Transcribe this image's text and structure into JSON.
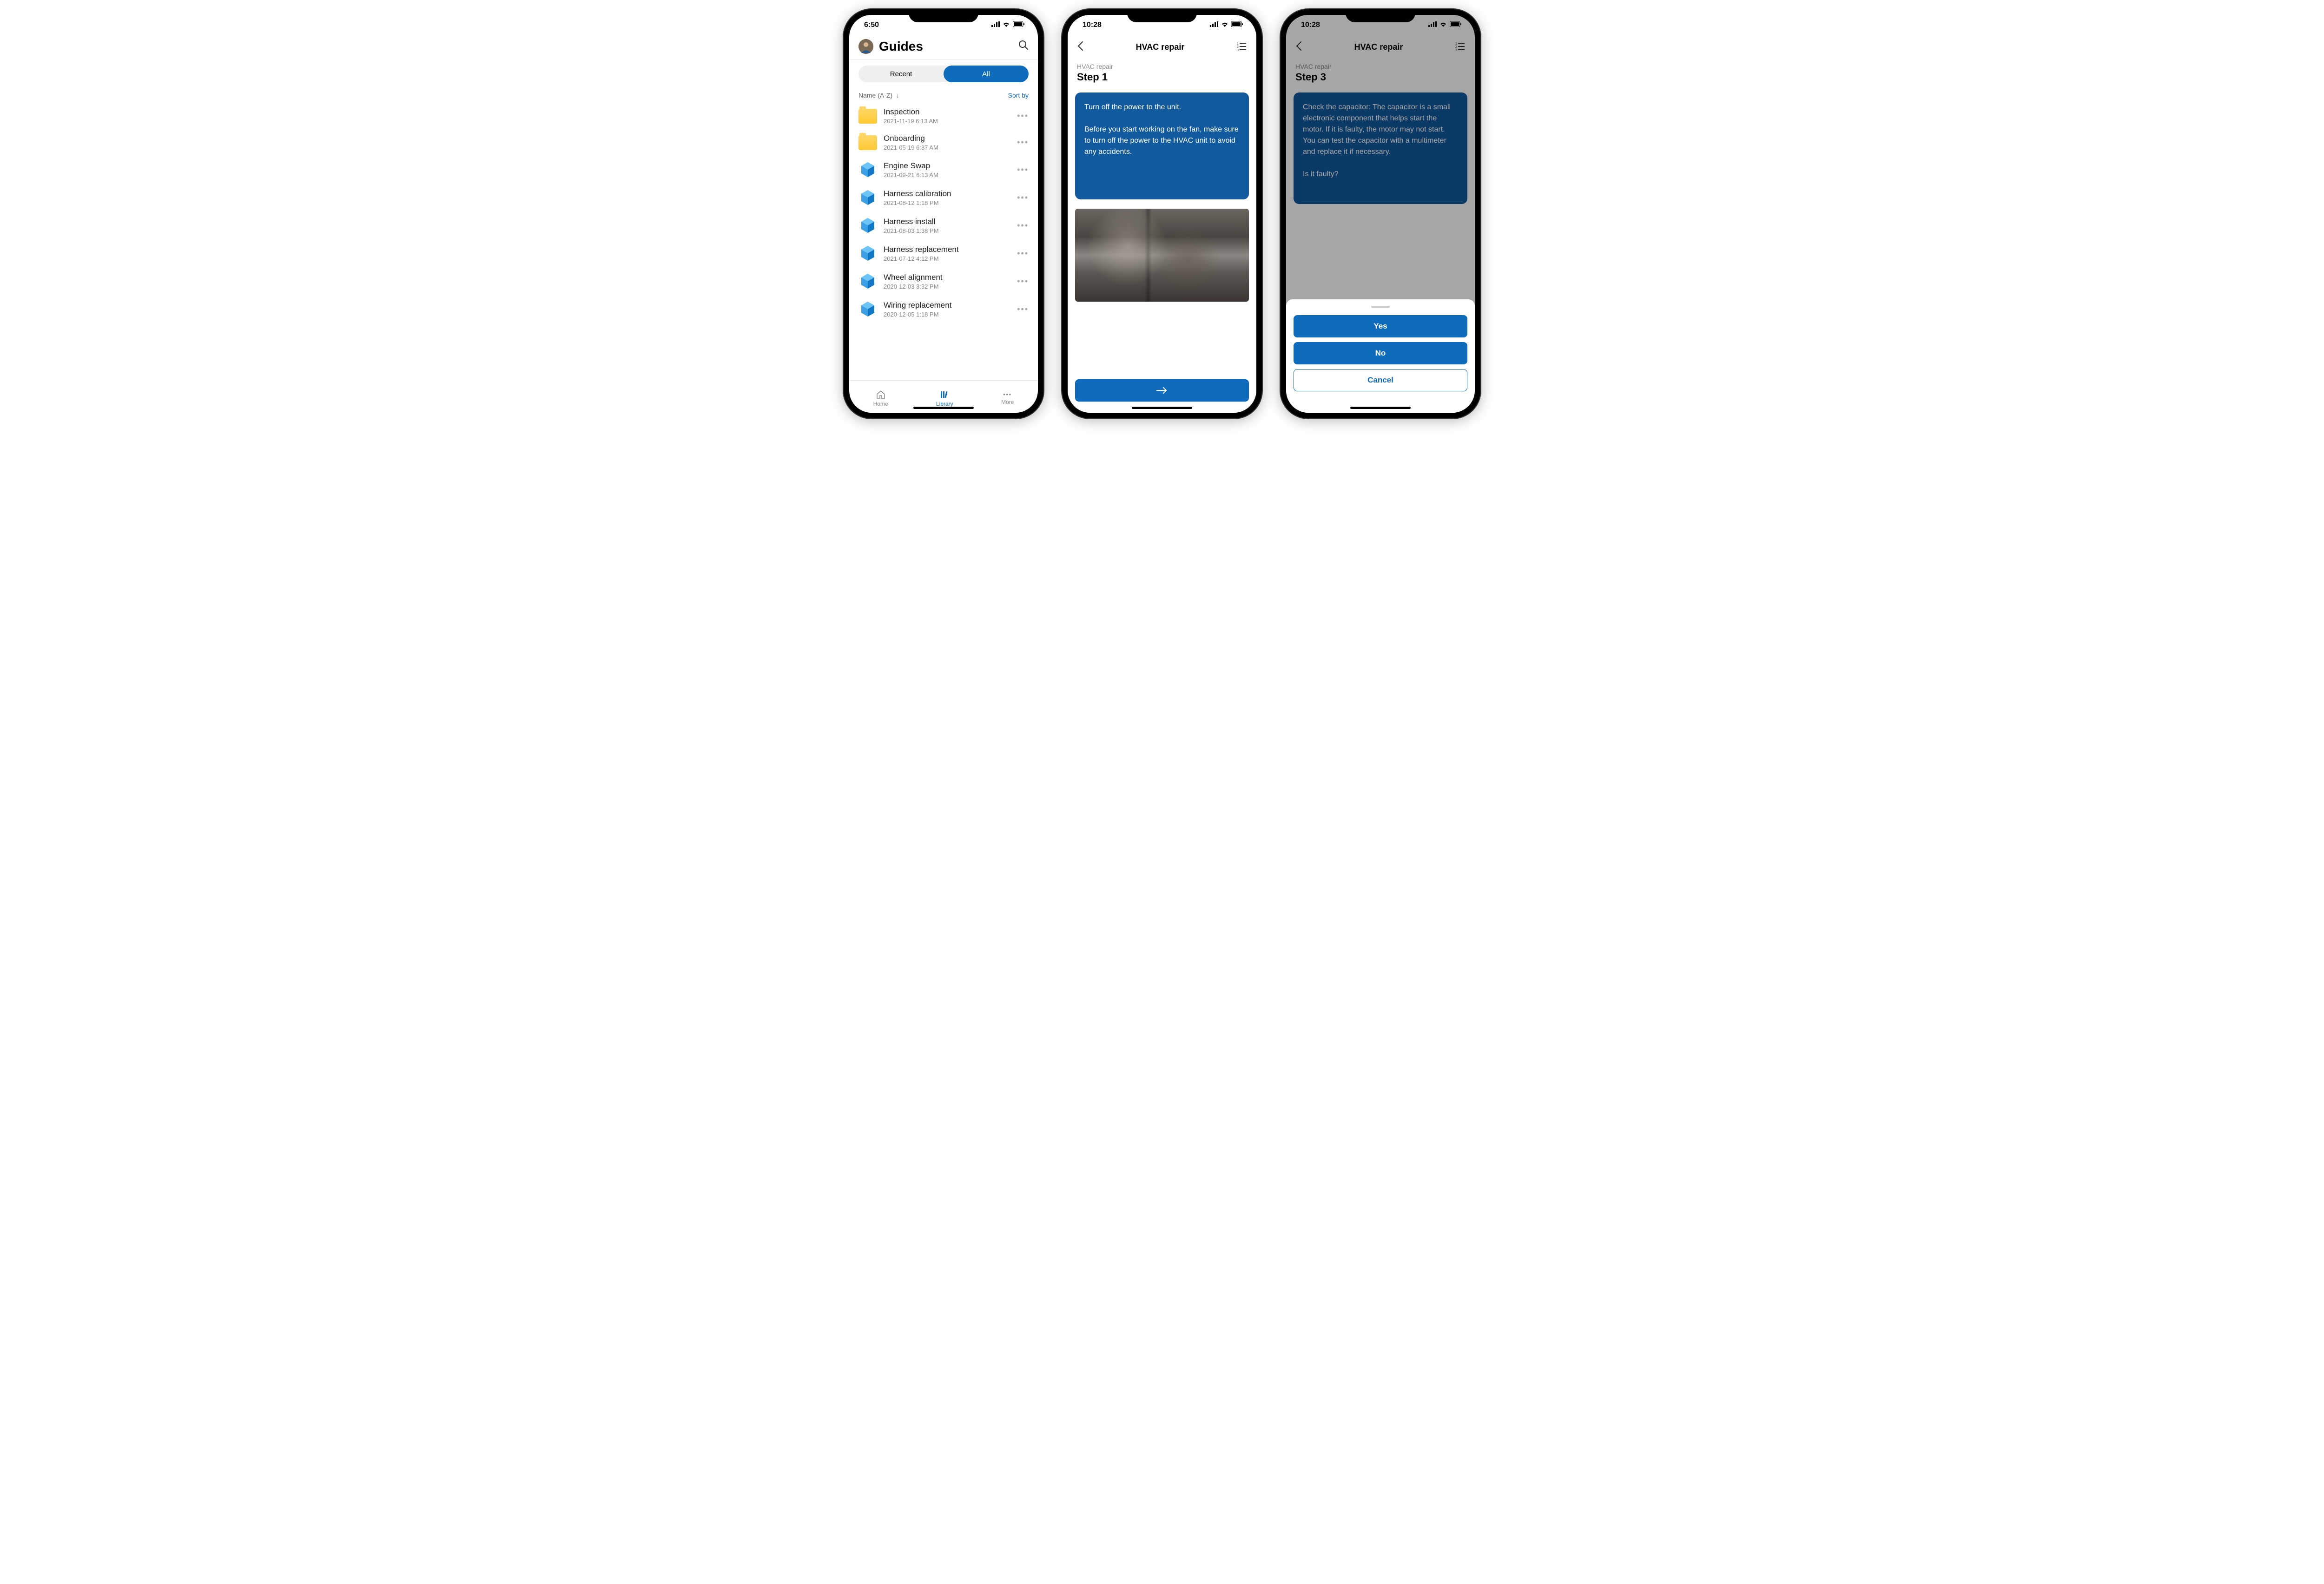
{
  "phone1": {
    "time": "6:50",
    "title": "Guides",
    "segments": {
      "recent": "Recent",
      "all": "All"
    },
    "sort_label": "Name (A-Z)",
    "sort_link": "Sort by",
    "items": [
      {
        "type": "folder",
        "title": "Inspection",
        "sub": "2021-11-19 6:13 AM"
      },
      {
        "type": "folder",
        "title": "Onboarding",
        "sub": "2021-05-19 6:37 AM"
      },
      {
        "type": "guide",
        "title": "Engine Swap",
        "sub": "2021-09-21 6:13 AM"
      },
      {
        "type": "guide",
        "title": "Harness calibration",
        "sub": "2021-08-12 1:18 PM"
      },
      {
        "type": "guide",
        "title": "Harness install",
        "sub": "2021-08-03 1:38 PM"
      },
      {
        "type": "guide",
        "title": "Harness replacement",
        "sub": "2021-07-12 4:12 PM"
      },
      {
        "type": "guide",
        "title": "Wheel alignment",
        "sub": "2020-12-03 3:32 PM"
      },
      {
        "type": "guide",
        "title": "Wiring replacement",
        "sub": "2020-12-05 1:18 PM"
      }
    ],
    "tabs": {
      "home": "Home",
      "library": "Library",
      "more": "More"
    }
  },
  "phone2": {
    "time": "10:28",
    "title": "HVAC repair",
    "breadcrumb": "HVAC repair",
    "step": "Step 1",
    "instruction": "Turn off the power to the unit.\n\nBefore you start working on the fan, make sure to turn off the power to the HVAC unit to avoid any accidents."
  },
  "phone3": {
    "time": "10:28",
    "title": "HVAC repair",
    "breadcrumb": "HVAC repair",
    "step": "Step 3",
    "instruction": "Check the capacitor: The capacitor is a small electronic component that helps start the motor. If it is faulty, the motor may not start. You can test the capacitor with a multimeter and replace it if necessary.\n\nIs it faulty?",
    "sheet": {
      "yes": "Yes",
      "no": "No",
      "cancel": "Cancel"
    }
  }
}
